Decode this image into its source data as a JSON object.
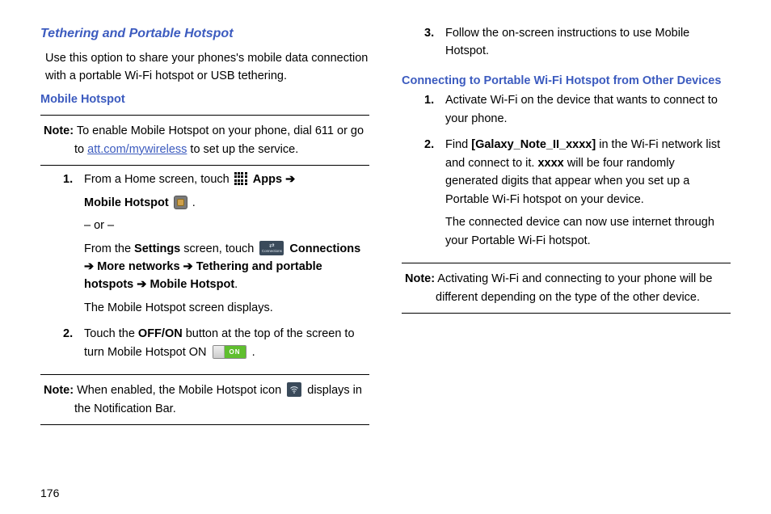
{
  "page_number": "176",
  "col1": {
    "h3": "Tethering and Portable Hotspot",
    "intro": "Use this option to share your phones's mobile data connection with a portable Wi-Fi hotspot or USB tethering.",
    "h4_mobile": "Mobile Hotspot",
    "note1_label": "Note:",
    "note1_pre": " To enable Mobile Hotspot on your phone, dial 611 or go to ",
    "note1_link": "att.com/mywireless",
    "note1_post": " to set up the service.",
    "step1_pre": "From a Home screen, touch ",
    "apps_label": " Apps ",
    "arrow": "➔",
    "mobile_hotspot_label": "Mobile Hotspot ",
    "step1_or": "– or –",
    "step1b_pre": "From the ",
    "settings_b": "Settings",
    "step1b_mid": " screen, touch ",
    "connections_b": " Connections ",
    "more_networks_b": "More networks ",
    "tethering_b": " Tethering and portable hotspots ",
    "mobile_hotspot_b2": "Mobile Hotspot",
    "step1_displays": "The Mobile Hotspot screen displays.",
    "step2_pre": "Touch the ",
    "offon_b": "OFF/ON",
    "step2_mid": " button at the top of the screen to turn Mobile Hotspot ON ",
    "on_switch_label": "ON",
    "note2_label": "Note:",
    "note2_pre": " When enabled, the Mobile Hotspot icon ",
    "note2_post": " displays in the Notification Bar.",
    "conn_text": "Connections"
  },
  "col2": {
    "step3": "Follow the on-screen instructions to use Mobile Hotspot.",
    "h4_connect": "Connecting to Portable Wi-Fi Hotspot from Other Devices",
    "b_step1": "Activate Wi-Fi on the device that wants to connect to your phone.",
    "b_step2_pre": "Find ",
    "b_step2_bold1": "[Galaxy_Note_II_xxxx]",
    "b_step2_mid1": " in the Wi-Fi network list and connect to it. ",
    "b_step2_bold2": "xxxx",
    "b_step2_mid2": " will be four randomly generated digits that appear when you set up a Portable Wi-Fi hotspot on your device.",
    "b_step2_sub": "The connected device can now use internet through your Portable Wi-Fi hotspot.",
    "note3_label": "Note:",
    "note3_text": " Activating Wi-Fi and connecting to your phone will be different depending on the type of the other device."
  },
  "nums": {
    "n1": "1.",
    "n2": "2.",
    "n3": "3."
  }
}
